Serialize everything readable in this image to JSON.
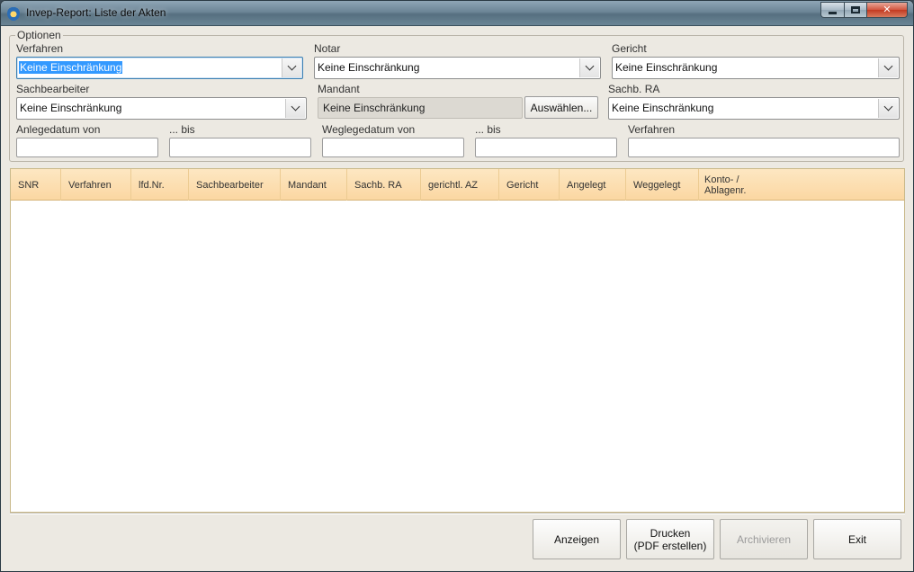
{
  "window": {
    "title": "Invep-Report: Liste der Akten"
  },
  "options": {
    "legend": "Optionen",
    "verfahren": {
      "label": "Verfahren",
      "value": "Keine Einschränkung"
    },
    "notar": {
      "label": "Notar",
      "value": "Keine Einschränkung"
    },
    "gericht": {
      "label": "Gericht",
      "value": "Keine Einschränkung"
    },
    "sachbearbeiter": {
      "label": "Sachbearbeiter",
      "value": "Keine Einschränkung"
    },
    "mandant": {
      "label": "Mandant",
      "value": "Keine Einschränkung",
      "button": "Auswählen..."
    },
    "sachb_ra": {
      "label": "Sachb. RA",
      "value": "Keine Einschränkung"
    },
    "anlegedatum_von": {
      "label": "Anlegedatum von",
      "value": ""
    },
    "anlegedatum_bis": {
      "label": "... bis",
      "value": ""
    },
    "weglegedatum_von": {
      "label": "Weglegedatum von",
      "value": ""
    },
    "weglegedatum_bis": {
      "label": "... bis",
      "value": ""
    },
    "verfahren_text": {
      "label": "Verfahren",
      "value": ""
    }
  },
  "table": {
    "columns": [
      "SNR",
      "Verfahren",
      "lfd.Nr.",
      "Sachbearbeiter",
      "Mandant",
      "Sachb. RA",
      "gerichtl. AZ",
      "Gericht",
      "Angelegt",
      "Weggelegt",
      "Konto- /\nAblagenr."
    ],
    "rows": []
  },
  "buttons": {
    "anzeigen": "Anzeigen",
    "drucken": "Drucken\n(PDF erstellen)",
    "archivieren": "Archivieren",
    "exit": "Exit"
  }
}
